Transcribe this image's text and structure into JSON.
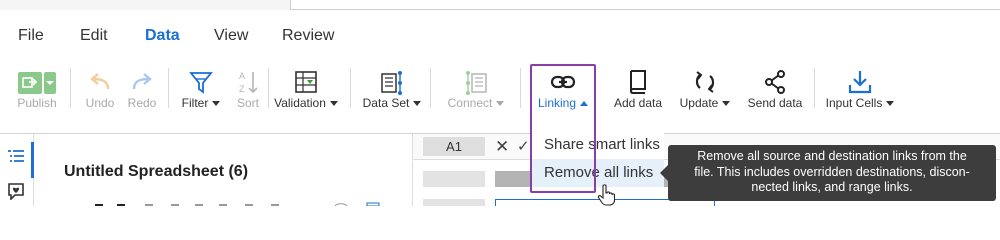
{
  "menu": {
    "items": [
      {
        "label": "File",
        "active": false
      },
      {
        "label": "Edit",
        "active": false
      },
      {
        "label": "Data",
        "active": true
      },
      {
        "label": "View",
        "active": false
      },
      {
        "label": "Review",
        "active": false
      }
    ]
  },
  "toolbar": {
    "publish": {
      "label": "Publish",
      "icon": "publish-icon",
      "enabled": false,
      "color": "#8bc98a"
    },
    "undo": {
      "label": "Undo",
      "icon": "undo-icon",
      "enabled": false
    },
    "redo": {
      "label": "Redo",
      "icon": "redo-icon",
      "enabled": false
    },
    "filter": {
      "label": "Filter",
      "icon": "filter-icon",
      "enabled": true
    },
    "sort": {
      "label": "Sort",
      "icon": "sort-icon",
      "enabled": false
    },
    "validation": {
      "label": "Validation",
      "icon": "validation-icon",
      "enabled": true
    },
    "data_set": {
      "label": "Data Set",
      "icon": "data-set-icon",
      "enabled": true
    },
    "connect": {
      "label": "Connect",
      "icon": "connect-icon",
      "enabled": false
    },
    "linking": {
      "label": "Linking",
      "icon": "link-icon",
      "enabled": true,
      "open": true,
      "accent": "#1a6fd4"
    },
    "add_data": {
      "label": "Add data",
      "icon": "book-icon",
      "enabled": true
    },
    "update": {
      "label": "Update",
      "icon": "refresh-icon",
      "enabled": true
    },
    "send_data": {
      "label": "Send data",
      "icon": "share-icon",
      "enabled": true
    },
    "input_cells": {
      "label": "Input Cells",
      "icon": "download-arrow-icon",
      "enabled": true
    }
  },
  "linking_menu": {
    "items": [
      {
        "label": "Share smart links",
        "hovered": false
      },
      {
        "label": "Remove all links",
        "hovered": true
      }
    ],
    "highlight_color": "#8a3fa8"
  },
  "tooltip": {
    "lines": [
      "Remove all source and destination links from the",
      "file. This includes overridden destinations, discon-",
      "nected links, and range links."
    ]
  },
  "sheet": {
    "title": "Untitled Spreadsheet (6)"
  },
  "formula_bar": {
    "cell_ref": "A1",
    "cancel_symbol": "✕",
    "confirm_symbol": "✓"
  },
  "colors": {
    "accent": "#1a6fd4",
    "disabled": "#a9a9a9"
  }
}
